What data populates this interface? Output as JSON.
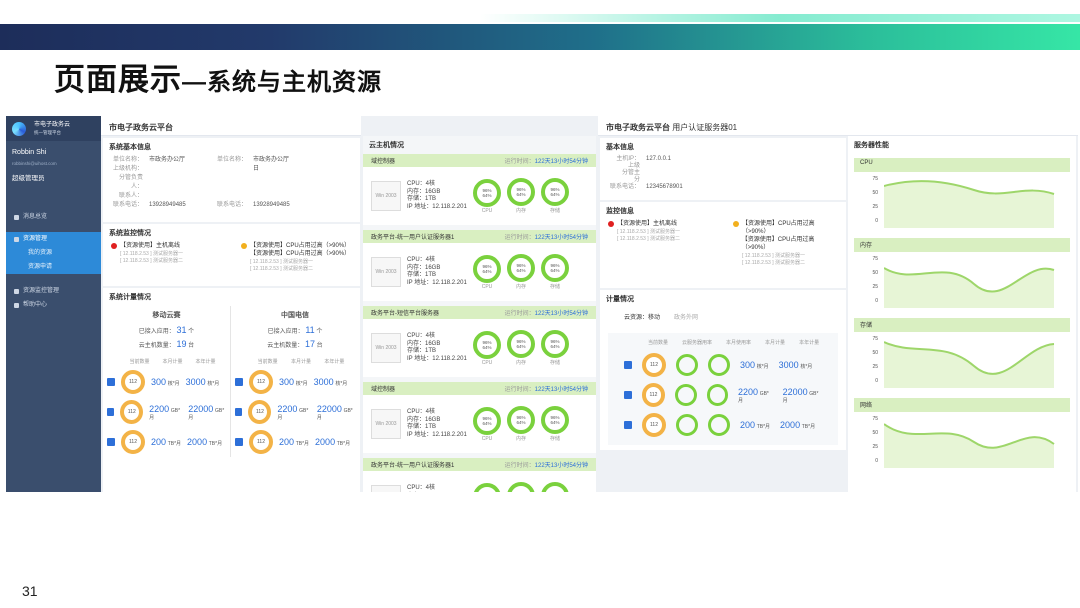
{
  "slide": {
    "title_main": "页面展示",
    "title_sub": "—系统与主机资源",
    "page_number": "31"
  },
  "sidebar": {
    "app_name": "市电子政务云",
    "app_sub": "统一管理平台",
    "user_name": "Robbin Shi",
    "user_email": "robbinshi@uihost.com",
    "role": "超级管理员",
    "items": [
      {
        "label": "消息总览"
      },
      {
        "label": "资源管理"
      },
      {
        "label": "我的资源"
      },
      {
        "label": "资源申请"
      },
      {
        "label": "资源监控管理"
      },
      {
        "label": "帮助中心"
      }
    ]
  },
  "left": {
    "header": "市电子政务云平台",
    "sys_info": {
      "title": "系统基本信息",
      "rows": [
        {
          "k": "单位名称：",
          "v": "市政务办公厅",
          "k2": "单位名称：",
          "v2": "市政务办公厅"
        },
        {
          "k": "上级机构：",
          "v": "",
          "k2": "",
          "v2": "日"
        },
        {
          "k": "分管负责人：",
          "v": "",
          "k2": "",
          "v2": ""
        },
        {
          "k": "联系人：",
          "v": "",
          "k2": "",
          "v2": ""
        },
        {
          "k": "联系电话：",
          "v": "13928949485",
          "k2": "联系电话：",
          "v2": "13928949485"
        }
      ]
    },
    "monitor": {
      "title": "系统监控情况",
      "a1": "【资源使用】主机离线",
      "a2": "【资源使用】CPU占用过高（>90%）",
      "a3": "【资源使用】CPU占用过高（>90%）",
      "g1": "[ 12.118.2.53 ] 测试服务器一",
      "g2": "[ 12.118.2.53 ] 测试服务器二"
    },
    "meter": {
      "title": "系统计量情况",
      "c1": "移动云赛",
      "c2": "中国电信",
      "l_app": "已接入应用：",
      "l_vm": "云主机数量：",
      "c1_app": "31",
      "c1_vm": "19",
      "c2_app": "11",
      "c2_vm": "17",
      "u_ge": "个",
      "u_tai": "台",
      "cols": [
        "当前数量",
        "本月计量",
        "本年计量"
      ],
      "ring": "112",
      "rows": [
        {
          "m": "300",
          "mu": "核*月",
          "y": "3000",
          "yu": "核*月"
        },
        {
          "m": "2200",
          "mu": "GB*月",
          "y": "22000",
          "yu": "GB*月"
        },
        {
          "m": "200",
          "mu": "TB*月",
          "y": "2000",
          "yu": "TB*月"
        }
      ]
    }
  },
  "mid": {
    "title": "云主机情况",
    "spec": {
      "cpu": "CPU：4核",
      "mem": "内存：16GB",
      "disk": "存储：1TB",
      "ip": "IP 地址：12.118.2.201"
    },
    "run_label": "运行时间：",
    "run_value": "122天13小时54分钟",
    "ring_top": "96%",
    "ring_bottom": "64%",
    "ring_labels": [
      "CPU",
      "内存",
      "存储"
    ],
    "os": "Win 2003",
    "vms": [
      {
        "name": "域控制器"
      },
      {
        "name": "政务平台-统一用户认证服务器1"
      },
      {
        "name": "政务平台-短信平台服务器"
      },
      {
        "name": "域控制器"
      },
      {
        "name": "政务平台-统一用户认证服务器1"
      }
    ]
  },
  "right": {
    "header": "市电子政务云平台",
    "header_sub": "用户认证服务器01",
    "basic": {
      "title": "基本信息",
      "rows": [
        {
          "k": "主机IP：",
          "v": "127.0.0.1"
        },
        {
          "k": "上级",
          "v": ""
        },
        {
          "k": "分管主",
          "v": ""
        },
        {
          "k": "分",
          "v": ""
        },
        {
          "k": "联系电话：",
          "v": "12345678901"
        }
      ]
    },
    "monitor": {
      "title": "监控信息",
      "a1": "【资源使用】主机离线",
      "a2": "【资源使用】CPU占用过高（>90%）",
      "a3": "【资源使用】CPU占用过高（>90%）",
      "g1": "[ 12.118.2.53 ] 测试服务器一",
      "g2": "[ 12.118.2.53 ] 测试服务器二"
    },
    "meter": {
      "title": "计量情况",
      "tab1": "云资源：移动",
      "tab2": "政务外网",
      "cols": [
        "当前数量",
        "云服务器用率",
        "本月使用率",
        "本月计量",
        "本年计量"
      ],
      "ring": "112",
      "rows": [
        {
          "m": "300",
          "mu": "核*月",
          "y": "3000",
          "yu": "核*月"
        },
        {
          "m": "2200",
          "mu": "GB*月",
          "y": "22000",
          "yu": "GB*月"
        },
        {
          "m": "200",
          "mu": "TB*月",
          "y": "2000",
          "yu": "TB*月"
        }
      ]
    },
    "perf": {
      "title": "服务器性能",
      "charts": [
        "CPU",
        "内存",
        "存储",
        "网络"
      ],
      "ticks": [
        "75",
        "50",
        "25",
        "0"
      ]
    }
  }
}
